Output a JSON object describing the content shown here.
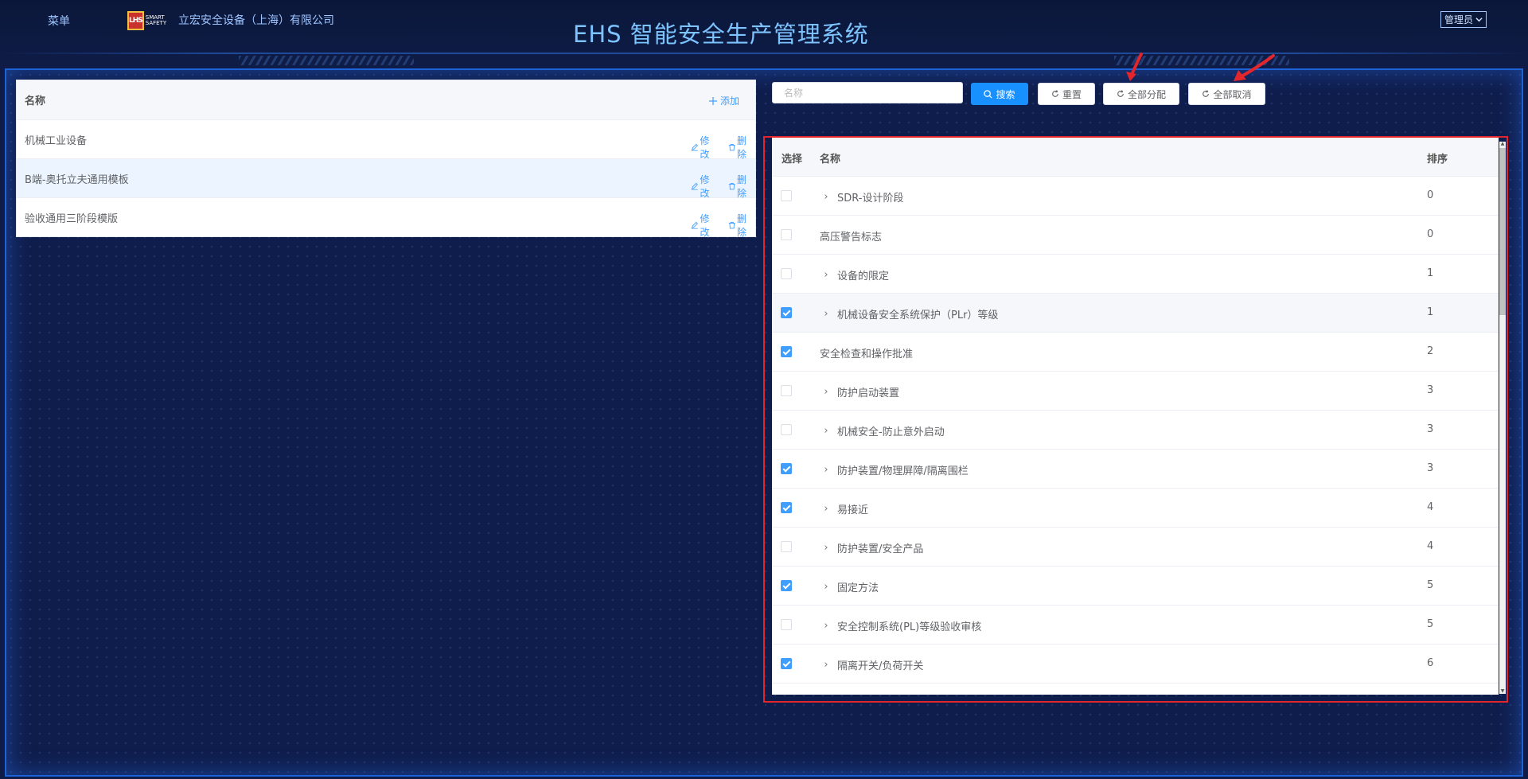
{
  "header": {
    "menu_label": "菜单",
    "logo_badge": "LHS",
    "logo_tagline": "SMART SAFETY",
    "company_name": "立宏安全设备（上海）有限公司",
    "system_title": "EHS 智能安全生产管理系统",
    "user_role": "管理员"
  },
  "template_list": {
    "column_name": "名称",
    "add_label": "添加",
    "edit_label": "修改",
    "delete_label": "删除",
    "rows": [
      {
        "name": "机械工业设备",
        "active": false
      },
      {
        "name": "B端-奥托立夫通用模板",
        "active": true
      },
      {
        "name": "验收通用三阶段模版",
        "active": false
      }
    ]
  },
  "toolbar": {
    "search_placeholder": "名称",
    "search_label": "搜索",
    "reset_label": "重置",
    "assign_all_label": "全部分配",
    "cancel_all_label": "全部取消"
  },
  "item_table": {
    "col_select": "选择",
    "col_name": "名称",
    "col_sort": "排序",
    "rows": [
      {
        "name": "SDR-设计阶段",
        "sort": "0",
        "checked": false,
        "expandable": true
      },
      {
        "name": "高压警告标志",
        "sort": "0",
        "checked": false,
        "expandable": false
      },
      {
        "name": "设备的限定",
        "sort": "1",
        "checked": false,
        "expandable": true
      },
      {
        "name": "机械设备安全系统保护（PLr）等级",
        "sort": "1",
        "checked": true,
        "expandable": true
      },
      {
        "name": "安全检查和操作批准",
        "sort": "2",
        "checked": true,
        "expandable": false
      },
      {
        "name": "防护启动装置",
        "sort": "3",
        "checked": false,
        "expandable": true
      },
      {
        "name": "机械安全-防止意外启动",
        "sort": "3",
        "checked": false,
        "expandable": true
      },
      {
        "name": "防护装置/物理屏障/隔离围栏",
        "sort": "3",
        "checked": true,
        "expandable": true
      },
      {
        "name": "易接近",
        "sort": "4",
        "checked": true,
        "expandable": true
      },
      {
        "name": "防护装置/安全产品",
        "sort": "4",
        "checked": false,
        "expandable": true
      },
      {
        "name": "固定方法",
        "sort": "5",
        "checked": true,
        "expandable": true
      },
      {
        "name": "安全控制系统(PL)等级验收审核",
        "sort": "5",
        "checked": false,
        "expandable": true
      },
      {
        "name": "隔离开关/负荷开关",
        "sort": "6",
        "checked": true,
        "expandable": true
      }
    ]
  },
  "colors": {
    "primary": "#1890ff",
    "link": "#409eff",
    "highlight_outline": "#e3262c",
    "background": "#0f1c48"
  }
}
